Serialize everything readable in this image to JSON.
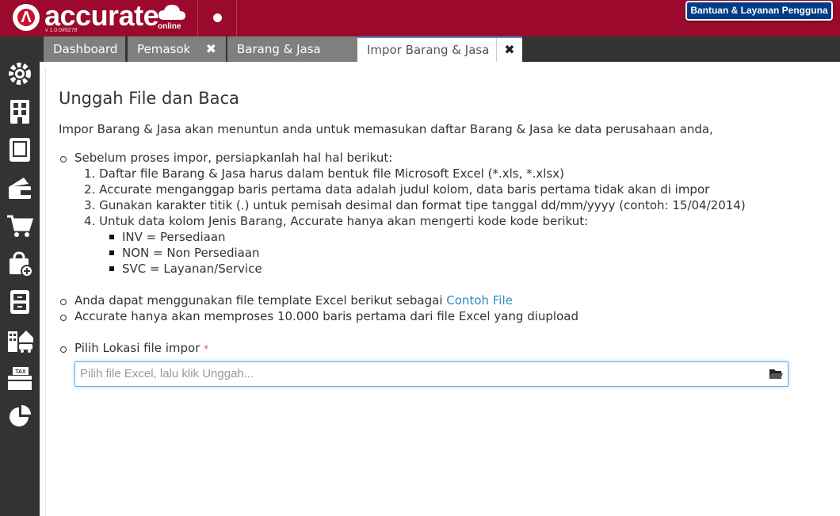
{
  "header": {
    "brand": "accurate",
    "online": "online",
    "version": "v 1.0.0#9278",
    "help_button": "Bantuan & Layanan Pengguna"
  },
  "tabs": [
    {
      "label": "Dashboard"
    },
    {
      "label": "Pemasok",
      "close": "✖"
    },
    {
      "label": "Barang & Jasa",
      "close": "✖"
    },
    {
      "label": "Impor Barang & Jasa",
      "close": "✖",
      "active": true
    }
  ],
  "sidebar": {
    "icons": [
      "settings-icon",
      "company-icon",
      "ledger-icon",
      "cash-bank-icon",
      "purchase-cart-icon",
      "sales-bag-icon",
      "inventory-icon",
      "fixed-assets-icon",
      "tax-icon",
      "report-pie-icon"
    ]
  },
  "main": {
    "title": "Unggah File dan Baca",
    "intro": "Impor Barang & Jasa akan menuntun anda untuk memasukan daftar Barang & Jasa ke data perusahaan anda,",
    "prep_heading": "Sebelum proses impor, persiapkanlah hal hal berikut:",
    "steps": [
      "1. Daftar file Barang & Jasa harus dalam bentuk file Microsoft Excel (*.xls, *.xlsx)",
      "2. Accurate menganggap baris pertama data adalah judul kolom, data baris pertama tidak akan di impor",
      "3. Gunakan karakter titik (.) untuk pemisah desimal dan format tipe tanggal dd/mm/yyyy (contoh: 15/04/2014)",
      "4. Untuk data kolom Jenis Barang, Accurate hanya akan mengerti kode kode berikut:"
    ],
    "codes": [
      "INV = Persediaan",
      "NON = Non Persediaan",
      "SVC = Layanan/Service"
    ],
    "template_text": "Anda dapat menggunakan file template Excel berikut sebagai ",
    "template_link": "Contoh File",
    "limit_text": "Accurate hanya akan memproses 10.000 baris pertama dari file Excel yang diupload",
    "file_label": "Pilih Lokasi file impor",
    "required_mark": "*",
    "file_placeholder": "Pilih file Excel, lalu klik Unggah..."
  },
  "colors": {
    "header_bg": "#9b0a2c",
    "sidebar_bg": "#333333",
    "tab_bg": "#7f7f7f",
    "help_button_bg": "#003c85",
    "link": "#2e8bc9"
  }
}
